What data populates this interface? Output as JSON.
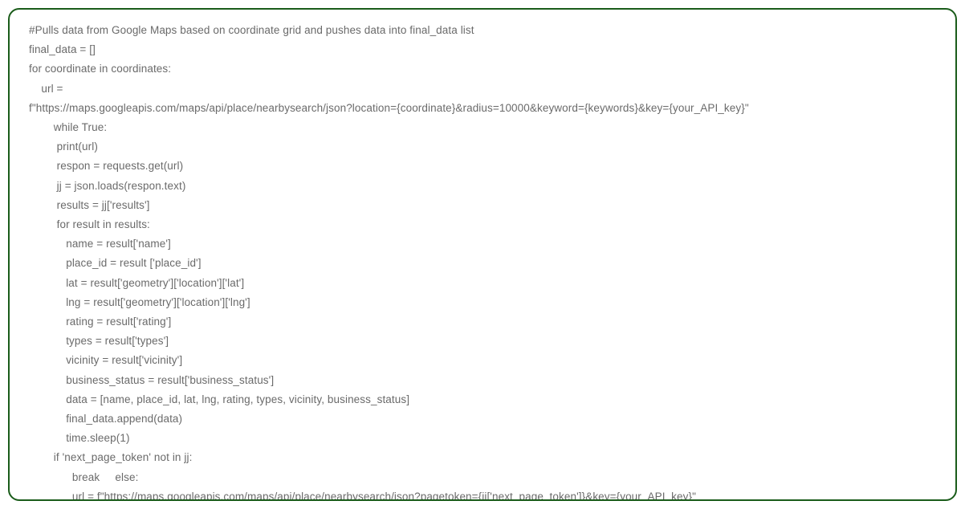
{
  "code": {
    "lines": [
      "#Pulls data from Google Maps based on coordinate grid and pushes data into final_data list",
      "final_data = []",
      "for coordinate in coordinates:",
      "    url =",
      "f\"https://maps.googleapis.com/maps/api/place/nearbysearch/json?location={coordinate}&radius=10000&keyword={keywords}&key={your_API_key}\"",
      "        while True:",
      "         print(url)",
      "         respon = requests.get(url)",
      "         jj = json.loads(respon.text)",
      "         results = jj['results']",
      "         for result in results:",
      "            name = result['name']",
      "            place_id = result ['place_id']",
      "            lat = result['geometry']['location']['lat']",
      "            lng = result['geometry']['location']['lng']",
      "            rating = result['rating']",
      "            types = result['types']",
      "            vicinity = result['vicinity']",
      "            business_status = result['business_status']",
      "            data = [name, place_id, lat, lng, rating, types, vicinity, business_status]",
      "            final_data.append(data)",
      "            time.sleep(1)",
      "        if 'next_page_token' not in jj:",
      "              break     else:",
      "              url = f\"https://maps.googleapis.com/maps/api/place/nearbysearch/json?pagetoken={jj['next_page_token']}&key={your_API_key}\""
    ]
  }
}
